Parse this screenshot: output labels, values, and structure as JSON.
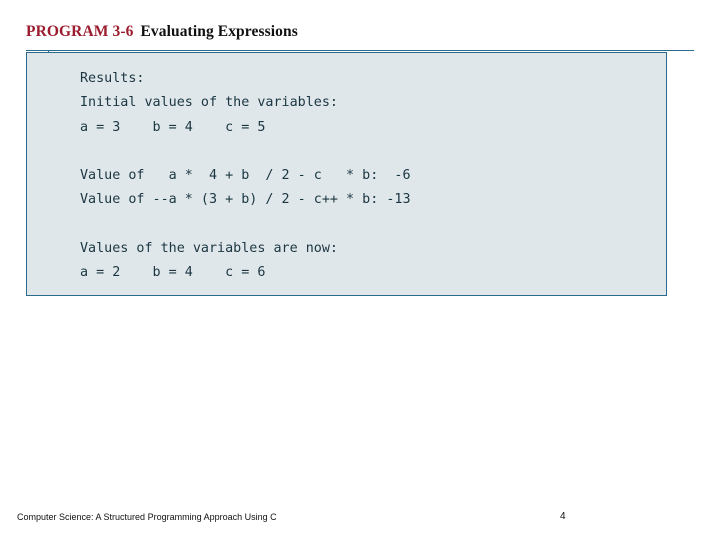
{
  "slide": {
    "title_main": "PROGRAM 3-6",
    "title_sub": "Evaluating Expressions",
    "accent_color": "#9b1c2e",
    "panel_border_color": "#2b6a8c",
    "panel_background": "#dfe7ea"
  },
  "code_output": {
    "lines": [
      "Results:",
      "Initial values of the variables:",
      "a = 3    b = 4    c = 5",
      "",
      "Value of   a *  4 + b  / 2 - c   * b:  -6",
      "Value of --a * (3 + b) / 2 - c++ * b: -13",
      "",
      "Values of the variables are now:",
      "a = 2    b = 4    c = 6"
    ],
    "full_text": "Results:\nInitial values of the variables:\na = 3    b = 4    c = 5\n\nValue of   a *  4 + b  / 2 - c   * b:  -6\nValue of --a * (3 + b) / 2 - c++ * b: -13\n\nValues of the variables are now:\na = 2    b = 4    c = 6"
  },
  "footer": {
    "source": "Computer Science: A Structured Programming Approach Using C",
    "page_number": "4"
  }
}
